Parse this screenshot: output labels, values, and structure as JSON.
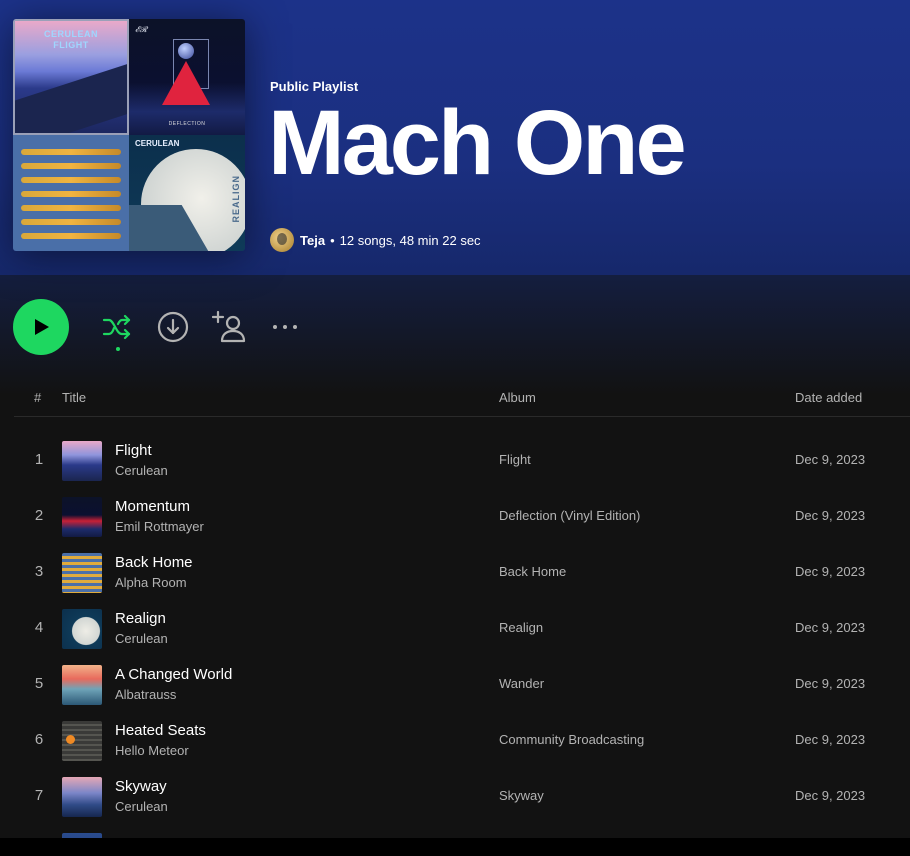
{
  "header": {
    "playlist_type": "Public Playlist",
    "title": "Mach One",
    "owner": "Teja",
    "bullet": "•",
    "stats": "12 songs, 48 min 22 sec"
  },
  "cover_art": {
    "tile1_line1": "CERULEAN",
    "tile1_line2": "FLIGHT",
    "tile2_label": "DEFLECTION",
    "tile4_label": "CERULEAN",
    "tile4_vertical": "REALIGN"
  },
  "controls": {
    "play_icon": "play-icon",
    "shuffle_icon": "shuffle-icon",
    "download_icon": "download-icon",
    "add_user_icon": "add-user-icon",
    "more_icon": "more-icon",
    "accent_color": "#1ed760"
  },
  "table": {
    "headers": {
      "num": "#",
      "title": "Title",
      "album": "Album",
      "date": "Date added"
    },
    "rows": [
      {
        "num": "1",
        "name": "Flight",
        "artist": "Cerulean",
        "album": "Flight",
        "date": "Dec 9, 2023"
      },
      {
        "num": "2",
        "name": "Momentum",
        "artist": "Emil Rottmayer",
        "album": "Deflection (Vinyl Edition)",
        "date": "Dec 9, 2023"
      },
      {
        "num": "3",
        "name": "Back Home",
        "artist": "Alpha Room",
        "album": "Back Home",
        "date": "Dec 9, 2023"
      },
      {
        "num": "4",
        "name": "Realign",
        "artist": "Cerulean",
        "album": "Realign",
        "date": "Dec 9, 2023"
      },
      {
        "num": "5",
        "name": "A Changed World",
        "artist": "Albatrauss",
        "album": "Wander",
        "date": "Dec 9, 2023"
      },
      {
        "num": "6",
        "name": "Heated Seats",
        "artist": "Hello Meteor",
        "album": "Community Broadcasting",
        "date": "Dec 9, 2023"
      },
      {
        "num": "7",
        "name": "Skyway",
        "artist": "Cerulean",
        "album": "Skyway",
        "date": "Dec 9, 2023"
      }
    ]
  }
}
